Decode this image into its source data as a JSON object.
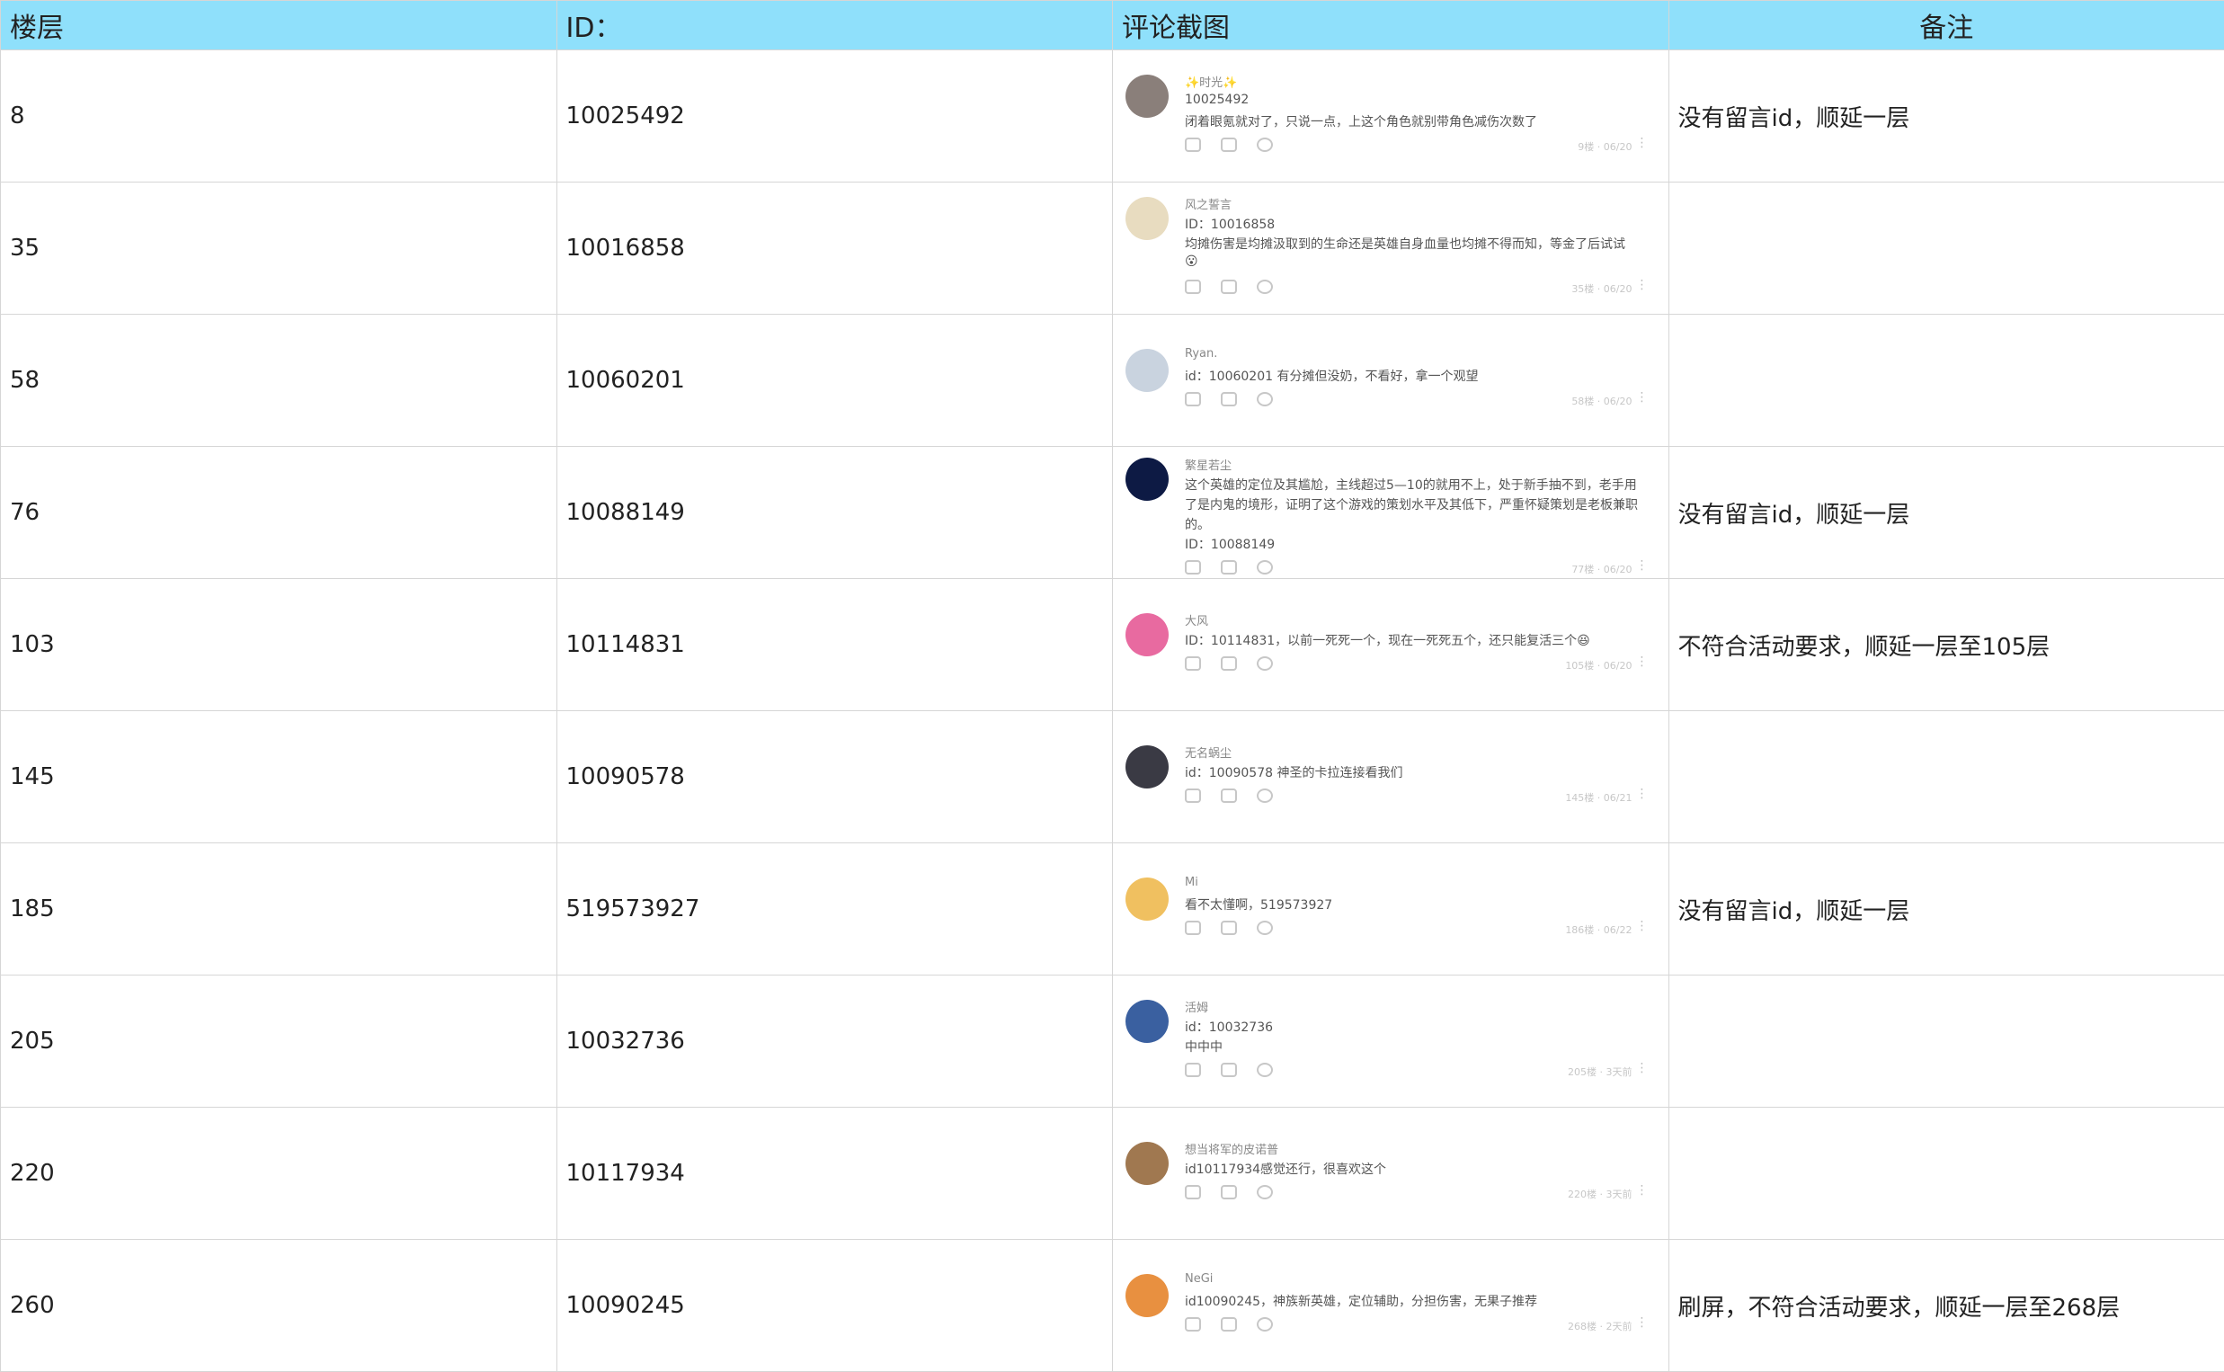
{
  "headers": [
    "楼层",
    "ID：",
    "评论截图",
    "备注"
  ],
  "rows": [
    {
      "floor": "8",
      "id": "10025492",
      "note": "没有留言id，顺延一层",
      "comment": {
        "name": "✨时光✨",
        "lines": [
          "10025492",
          "闭着眼氪就对了，只说一点，上这个角色就别带角色减伤次数了"
        ],
        "meta": "9楼 · 06/20",
        "avatar_color": "#8a7f7a"
      }
    },
    {
      "floor": "35",
      "id": "10016858",
      "note": "",
      "comment": {
        "name": "风之誓言",
        "lines": [
          "ID：10016858",
          "均摊伤害是均摊汲取到的生命还是英雄自身血量也均摊不得而知，等金了后试试",
          "😮"
        ],
        "meta": "35楼 · 06/20",
        "avatar_color": "#e8dcc0"
      }
    },
    {
      "floor": "58",
      "id": "10060201",
      "note": "",
      "comment": {
        "name": "Ryan.",
        "lines": [
          "id：10060201 有分摊但没奶，不看好，拿一个观望"
        ],
        "meta": "58楼 · 06/20",
        "avatar_color": "#c9d3df"
      }
    },
    {
      "floor": "76",
      "id": "10088149",
      "note": "没有留言id，顺延一层",
      "comment": {
        "name": "繁星若尘",
        "lines": [
          "这个英雄的定位及其尴尬，主线超过5—10的就用不上，处于新手抽不到，老手用",
          "了是内鬼的境形，证明了这个游戏的策划水平及其低下，严重怀疑策划是老板兼职",
          "的。",
          "ID：10088149"
        ],
        "meta": "77楼 · 06/20",
        "avatar_color": "#0d1a44"
      }
    },
    {
      "floor": "103",
      "id": "10114831",
      "note": "不符合活动要求，顺延一层至105层",
      "comment": {
        "name": "大风",
        "lines": [
          "ID：10114831，以前一死死一个，现在一死死五个，还只能复活三个😆"
        ],
        "meta": "105楼 · 06/20",
        "avatar_color": "#e86aa0"
      }
    },
    {
      "floor": "145",
      "id": "10090578",
      "note": "",
      "comment": {
        "name": "无名蜗尘",
        "lines": [
          "id：10090578 神圣的卡拉连接看我们"
        ],
        "meta": "145楼 · 06/21",
        "avatar_color": "#3a3a44"
      }
    },
    {
      "floor": "185",
      "id": "519573927",
      "note": "没有留言id，顺延一层",
      "comment": {
        "name": "Mi",
        "lines": [
          "看不太懂啊，519573927"
        ],
        "meta": "186楼 · 06/22",
        "avatar_color": "#f0c060"
      }
    },
    {
      "floor": "205",
      "id": "10032736",
      "note": "",
      "comment": {
        "name": "活姆",
        "lines": [
          "id：10032736",
          "中中中"
        ],
        "meta": "205楼 · 3天前",
        "avatar_color": "#3a60a0"
      }
    },
    {
      "floor": "220",
      "id": "10117934",
      "note": "",
      "comment": {
        "name": "想当将军的皮诺普",
        "lines": [
          "id10117934感觉还行，很喜欢这个"
        ],
        "meta": "220楼 · 3天前",
        "avatar_color": "#a07850"
      }
    },
    {
      "floor": "260",
      "id": "10090245",
      "note": "刷屏，不符合活动要求，顺延一层至268层",
      "comment": {
        "name": "NeGi",
        "lines": [
          "id10090245，神族新英雄，定位辅助，分担伤害，无果子推荐"
        ],
        "meta": "268楼 · 2天前",
        "avatar_color": "#e89040"
      }
    }
  ]
}
